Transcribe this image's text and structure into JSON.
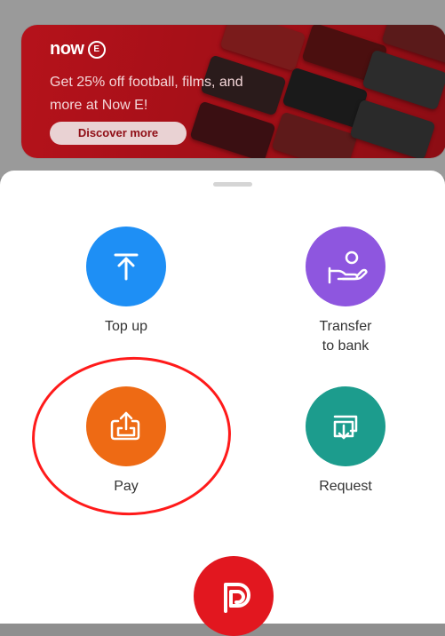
{
  "promo": {
    "logo_text": "now",
    "logo_badge": "E",
    "headline": "Get 25% off football, films, and more at Now E!",
    "cta_label": "Discover more",
    "brand_color": "#b5121b"
  },
  "actions": [
    {
      "id": "top_up",
      "label": "Top up",
      "icon": "upload-arrow-icon",
      "color": "#1e8ff5"
    },
    {
      "id": "transfer",
      "label": "Transfer\nto bank",
      "icon": "hand-user-icon",
      "color": "#8e56df"
    },
    {
      "id": "pay",
      "label": "Pay",
      "icon": "share-out-icon",
      "color": "#ee6a14"
    },
    {
      "id": "request",
      "label": "Request",
      "icon": "request-icon",
      "color": "#1c9c8d"
    }
  ],
  "bottom_brand_icon": "p-logo-icon",
  "annotation": {
    "color": "#ff1a1a"
  }
}
